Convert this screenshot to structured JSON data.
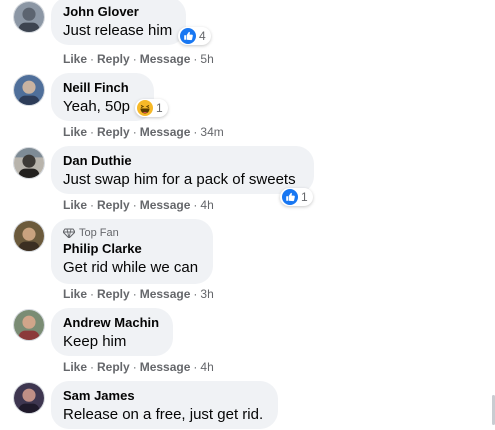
{
  "comments": [
    {
      "name": "John Glover",
      "text": "Just release him",
      "like": "Like",
      "reply": "Reply",
      "message": "Message",
      "time": "5h",
      "reaction_count": "4",
      "reaction_icon": "like-icon"
    },
    {
      "name": "Neill Finch",
      "text": "Yeah, 50p",
      "like": "Like",
      "reply": "Reply",
      "message": "Message",
      "time": "34m",
      "reaction_count": "1",
      "reaction_icon": "haha-icon"
    },
    {
      "name": "Dan Duthie",
      "text": "Just swap him for a pack of sweets",
      "like": "Like",
      "reply": "Reply",
      "message": "Message",
      "time": "4h",
      "reaction_count": "1",
      "reaction_icon": "like-icon"
    },
    {
      "badge": "Top Fan",
      "name": "Philip Clarke",
      "text": "Get rid while we can",
      "like": "Like",
      "reply": "Reply",
      "message": "Message",
      "time": "3h"
    },
    {
      "name": "Andrew Machin",
      "text": "Keep him",
      "like": "Like",
      "reply": "Reply",
      "message": "Message",
      "time": "4h"
    },
    {
      "name": "Sam James",
      "text": "Release on a free, just get rid."
    }
  ],
  "colors": {
    "like_blue": "#1877f2",
    "haha_yellow": "#f7b928",
    "bubble": "#f0f2f5",
    "meta_gray": "#65676b"
  }
}
